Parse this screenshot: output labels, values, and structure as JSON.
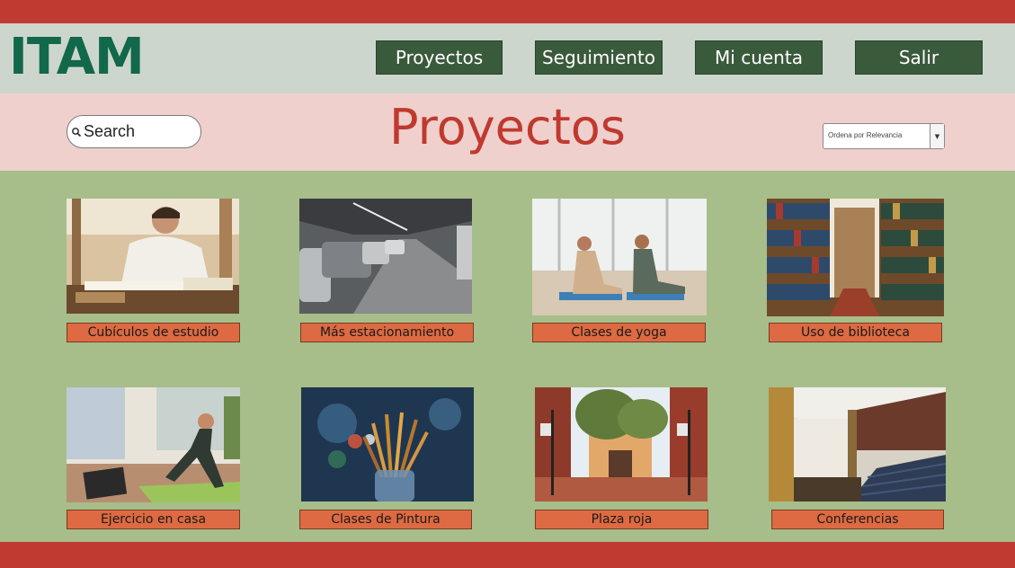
{
  "brand": {
    "logo_text": "ITAM",
    "logo_color": "#11684b"
  },
  "nav": [
    {
      "label": "Proyectos"
    },
    {
      "label": "Seguimiento"
    },
    {
      "label": "Mi cuenta"
    },
    {
      "label": "Salir"
    }
  ],
  "page": {
    "title": "Proyectos"
  },
  "search": {
    "placeholder": "Search",
    "value": ""
  },
  "sort": {
    "selected": "Ordena por Relevancia"
  },
  "projects": [
    {
      "label": "Cubículos de estudio",
      "image": "student-studying-photo"
    },
    {
      "label": "Más estacionamiento",
      "image": "parking-garage-photo"
    },
    {
      "label": "Clases de yoga",
      "image": "yoga-class-photo"
    },
    {
      "label": "Uso de biblioteca",
      "image": "library-shelves-photo"
    },
    {
      "label": "Ejercicio en casa",
      "image": "home-exercise-photo"
    },
    {
      "label": "Clases de Pintura",
      "image": "paint-brushes-photo"
    },
    {
      "label": "Plaza roja",
      "image": "red-plaza-photo"
    },
    {
      "label": "Conferencias",
      "image": "auditorium-photo"
    }
  ],
  "colors": {
    "top_bar": "#c13a31",
    "header_bg": "#cdd6cd",
    "nav_button": "#3a5a3c",
    "title_band": "#efd0cd",
    "title_text": "#c0392f",
    "content_bg": "#a7bd8a",
    "card_label": "#dd6a42"
  }
}
